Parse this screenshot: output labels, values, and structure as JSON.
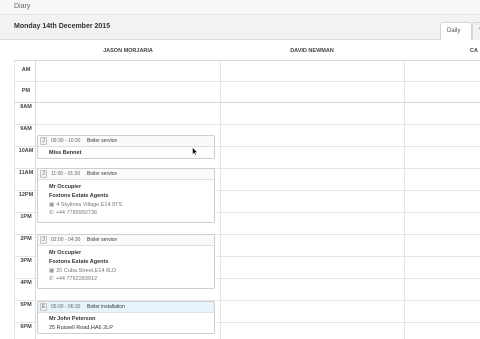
{
  "app": {
    "title": "Diary"
  },
  "header": {
    "date": "Monday 14th December 2015"
  },
  "tabs": [
    {
      "label": "Daily"
    },
    {
      "label": "V"
    }
  ],
  "columns": [
    {
      "label": "JASON MORJARIA"
    },
    {
      "label": "DAVID NEWMAN"
    },
    {
      "label": "CA"
    }
  ],
  "rows": {
    "am": "AM",
    "pm": "PM"
  },
  "hours": [
    "8AM",
    "9AM",
    "10AM",
    "11AM",
    "12PM",
    "1PM",
    "2PM",
    "3PM",
    "4PM",
    "5PM",
    "6PM"
  ],
  "appointments": [
    {
      "badge": "J",
      "time": "09:30 - 10:30",
      "type": "Boiler service",
      "name": "Miss Bennet"
    },
    {
      "badge": "J",
      "time": "11:00 - 01:30",
      "type": "Boiler service",
      "name": "Mr Occupier",
      "agent": "Foxtons Estate Agents",
      "address": "4 Skylines Village,E14 9TS",
      "phone": "+44 7789992736"
    },
    {
      "badge": "J",
      "time": "02:00 - 04:30",
      "type": "Boiler service",
      "name": "Mr Occupier",
      "agent": "Foxtons Estate Agents",
      "address": "20 Cuba Street,E14 8LD",
      "phone": "+44 7762283912"
    },
    {
      "badge": "E",
      "time": "05:00 - 06:30",
      "type": "Boiler installation",
      "name": "Mr John Peterson",
      "address": "25 Russell Road,HA6 2LP"
    }
  ],
  "icons": {
    "building": "building-icon",
    "phone": "phone-icon",
    "cursor": "mouse-cursor-icon"
  },
  "colors": {
    "installation_header": "#e6f3fb"
  }
}
